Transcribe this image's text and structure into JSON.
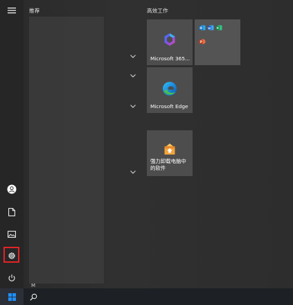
{
  "start_menu": {
    "recommended_label": "推荐",
    "productivity_label": "高效工作",
    "list_letter": "M"
  },
  "tiles": {
    "microsoft365": {
      "label": "Microsoft 365..."
    },
    "office_group": {
      "icons": [
        "outlook-icon",
        "word-icon",
        "excel-icon",
        "powerpoint-icon"
      ]
    },
    "edge": {
      "label": "Microsoft Edge"
    },
    "uninstaller": {
      "label": "强力卸载电脑中的软件"
    }
  },
  "rail": {
    "icons": [
      "hamburger-menu-icon",
      "user-icon",
      "documents-icon",
      "pictures-icon",
      "settings-icon",
      "power-icon"
    ],
    "highlighted": "settings-icon"
  },
  "taskbar": {
    "icons": [
      "windows-start-icon",
      "search-icon"
    ]
  },
  "colors": {
    "background": "#2b2b2b",
    "tile": "#4d4d4d",
    "highlight": "#e32326",
    "taskbar": "#1d2024",
    "windows_blue": "#1e90ff"
  }
}
